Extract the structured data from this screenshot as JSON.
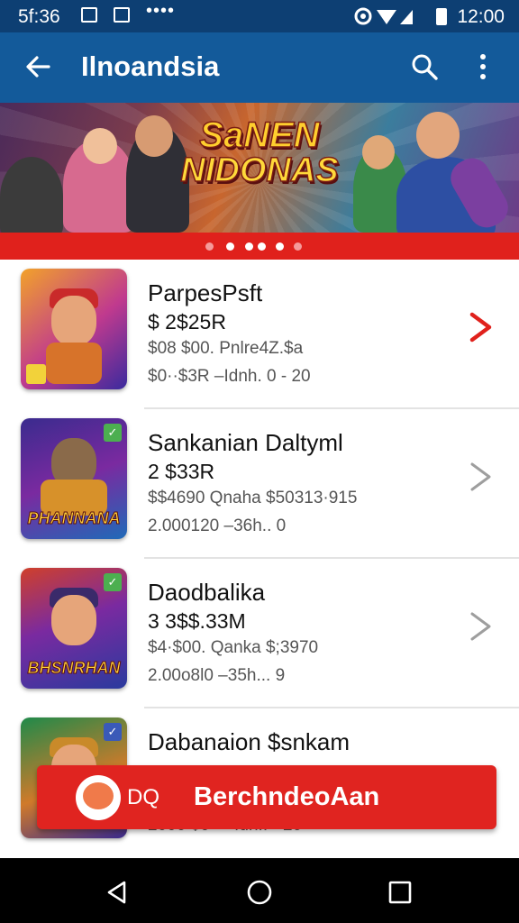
{
  "status_bar": {
    "time": "5f:36",
    "right_time": "12:00",
    "dots": "••••"
  },
  "app_bar": {
    "title": "Ilnoandsia",
    "back_icon": "arrow-left-icon",
    "search_icon": "search-icon",
    "menu_icon": "more-vert-icon"
  },
  "banner": {
    "line1": "SaNEN",
    "line2": "NIDONAS",
    "page_count": 5,
    "active_page": 2
  },
  "items": [
    {
      "name": "ParpesPsft",
      "price": "$ 2$25R",
      "line1": "$08 $00. Pnlre4Z.$a",
      "line2": "$0··$3R  –Idnh. 0  - 20",
      "thumb_caption": "",
      "accent": "#e0211c"
    },
    {
      "name": "Sankanian Daltyml",
      "price": "2 $33R",
      "line1": "$$4690 Qnaha $50313·915",
      "line2": "2.000120 –36h.. 0",
      "thumb_caption": "PHANNANA",
      "accent": "#9e9e9e"
    },
    {
      "name": "Daodbalika",
      "price": "3 3$$.33M",
      "line1": "$4·$00. Qanka $;3970",
      "line2": "2.00o8l0 –35h... 9",
      "thumb_caption": "BHSNRHAN",
      "accent": "#9e9e9e"
    },
    {
      "name": "Dabanaion $snkam",
      "price": "",
      "line1": "",
      "line2": "2000 $0 – ·fuh..  ·  20",
      "thumb_caption": "",
      "accent": "#9e9e9e"
    }
  ],
  "cta": {
    "prefix": "DQ",
    "label": "BerchndeoAan"
  },
  "nav_bar": {
    "back_icon": "nav-back-icon",
    "home_icon": "nav-home-icon",
    "recents_icon": "nav-recents-icon"
  },
  "colors": {
    "status": "#0d3f73",
    "app_bar": "#135a9a",
    "accent_red": "#e0211c"
  }
}
